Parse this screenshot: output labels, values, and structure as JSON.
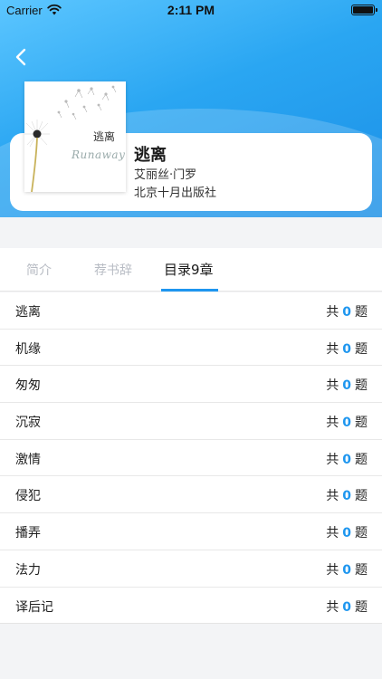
{
  "status_bar": {
    "carrier": "Carrier",
    "time": "2:11 PM"
  },
  "colors": {
    "accent": "#1e96ef",
    "header_gradient_start": "#5cc6ff",
    "header_gradient_end": "#1b8fe6"
  },
  "book": {
    "title": "逃离",
    "author": "艾丽丝·门罗",
    "publisher": "北京十月出版社",
    "cover": {
      "title": "逃离",
      "subtitle": "Runaway"
    }
  },
  "tabs": [
    {
      "label": "简介",
      "active": false
    },
    {
      "label": "荐书辞",
      "active": false
    },
    {
      "label": "目录9章",
      "active": true
    }
  ],
  "chapters": [
    {
      "name": "逃离",
      "prefix": "共",
      "count": "0",
      "suffix": "题"
    },
    {
      "name": "机缘",
      "prefix": "共",
      "count": "0",
      "suffix": "题"
    },
    {
      "name": "匆匆",
      "prefix": "共",
      "count": "0",
      "suffix": "题"
    },
    {
      "name": "沉寂",
      "prefix": "共",
      "count": "0",
      "suffix": "题"
    },
    {
      "name": "激情",
      "prefix": "共",
      "count": "0",
      "suffix": "题"
    },
    {
      "name": "侵犯",
      "prefix": "共",
      "count": "0",
      "suffix": "题"
    },
    {
      "name": "播弄",
      "prefix": "共",
      "count": "0",
      "suffix": "题"
    },
    {
      "name": "法力",
      "prefix": "共",
      "count": "0",
      "suffix": "题"
    },
    {
      "name": "译后记",
      "prefix": "共",
      "count": "0",
      "suffix": "题"
    }
  ]
}
